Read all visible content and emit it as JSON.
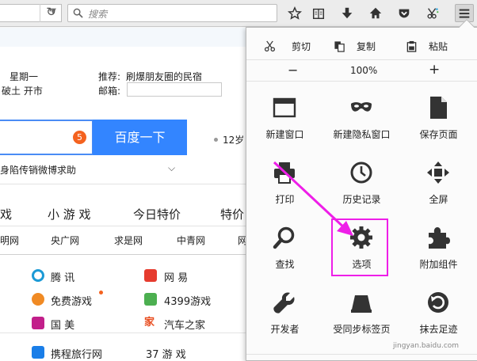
{
  "toolbar": {
    "search_placeholder": "搜索",
    "icons": [
      "bookmark-star-icon",
      "reading-list-icon",
      "download-icon",
      "home-icon",
      "pocket-icon",
      "screenshot-icon",
      "hamburger-menu-icon"
    ]
  },
  "page": {
    "date_weekday": "星期一",
    "location_line": "破土 开市",
    "recommend_label": "推荐:",
    "recommend_text": "刷爆朋友圈的民宿",
    "email_label": "邮箱:",
    "badge_count": "5",
    "baidu_button": "百度一下",
    "side_text": "12岁",
    "news_item": "身陷传销微博求助",
    "nav_row": [
      "戏",
      "小 游 戏",
      "今日特价",
      "特价"
    ],
    "site_row": [
      "明网",
      "央广网",
      "求是网",
      "中青网",
      "网"
    ],
    "links": [
      {
        "name": "腾  讯",
        "icon": "tencent-icon"
      },
      {
        "name": "网  易",
        "icon": "netease-icon"
      },
      {
        "name": "免费游戏",
        "icon": "game-icon"
      },
      {
        "name": "4399游戏",
        "icon": "4399-icon"
      },
      {
        "name": "国  美",
        "icon": "gome-icon"
      },
      {
        "name": "汽车之家",
        "icon": "autohome-icon"
      },
      {
        "name": "携程旅行网",
        "icon": "ctrip-icon"
      },
      {
        "name": "37 游 戏",
        "icon": ""
      }
    ]
  },
  "menu": {
    "edit": {
      "cut": "剪切",
      "copy": "复制",
      "paste": "粘贴"
    },
    "zoom": {
      "minus": "−",
      "level": "100%",
      "plus": "+"
    },
    "tiles": [
      {
        "label": "新建窗口",
        "icon": "new-window-icon"
      },
      {
        "label": "新建隐私窗口",
        "icon": "private-mask-icon"
      },
      {
        "label": "保存页面",
        "icon": "save-page-icon"
      },
      {
        "label": "打印",
        "icon": "print-icon"
      },
      {
        "label": "历史记录",
        "icon": "history-clock-icon"
      },
      {
        "label": "全屏",
        "icon": "fullscreen-icon"
      },
      {
        "label": "查找",
        "icon": "find-icon"
      },
      {
        "label": "选项",
        "icon": "options-gear-icon"
      },
      {
        "label": "附加组件",
        "icon": "addons-puzzle-icon"
      },
      {
        "label": "开发者",
        "icon": "developer-wrench-icon"
      },
      {
        "label": "受同步标签页",
        "icon": "synced-tabs-icon"
      },
      {
        "label": "抹去足迹",
        "icon": "forget-history-icon"
      }
    ],
    "highlight_color": "#ee1ee8"
  },
  "watermark": "jingyan.baidu.com"
}
